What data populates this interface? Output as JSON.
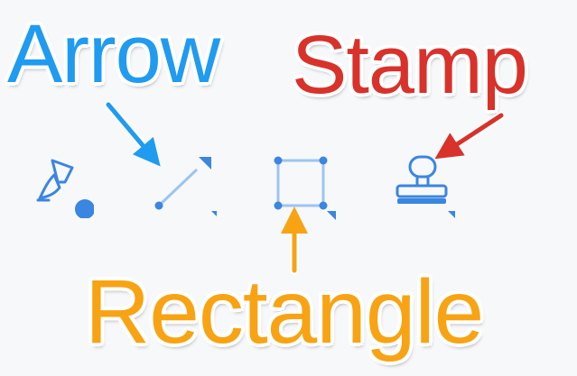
{
  "colors": {
    "arrow": "#1f9bf0",
    "stamp": "#d8322b",
    "rectangle": "#f8a313",
    "tool_icon": "#3a86e0",
    "tool_icon_light": "#9cc5f2"
  },
  "callouts": {
    "arrow": "Arrow",
    "stamp": "Stamp",
    "rectangle": "Rectangle"
  },
  "toolbar": {
    "tools": [
      {
        "name": "highlighter",
        "icon": "highlighter-icon"
      },
      {
        "name": "arrow",
        "icon": "arrow-tool-icon"
      },
      {
        "name": "rectangle",
        "icon": "rectangle-tool-icon"
      },
      {
        "name": "stamp",
        "icon": "stamp-tool-icon"
      }
    ]
  }
}
